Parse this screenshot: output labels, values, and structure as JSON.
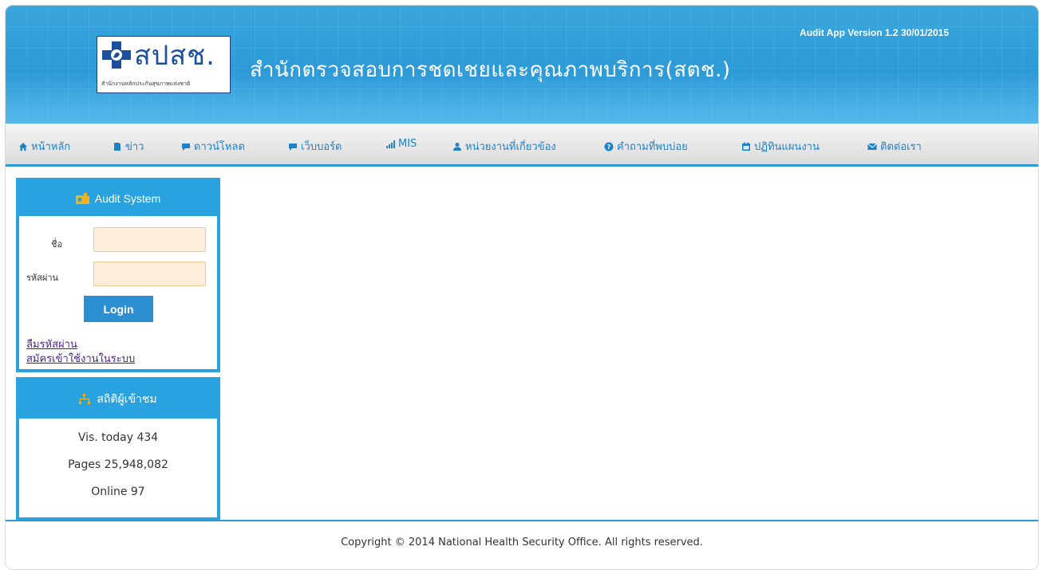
{
  "header": {
    "logo_text": "สปสช.",
    "logo_subtitle": "สำนักงานหลักประกันสุขภาพแห่งชาติ",
    "site_title": "สำนักตรวจสอบการชดเชยและคุณภาพบริการ(สตช.)",
    "app_version": "Audit App Version 1.2 30/01/2015"
  },
  "nav": {
    "items": [
      {
        "label": "หน้าหลัก",
        "icon": "home-icon"
      },
      {
        "label": "ข่าว",
        "icon": "document-icon"
      },
      {
        "label": "ดาวน์โหลด",
        "icon": "comment-icon"
      },
      {
        "label": "เว็บบอร์ด",
        "icon": "comment-icon"
      },
      {
        "label": "MIS",
        "icon": "signal-icon"
      },
      {
        "label": "หน่วยงานที่เกี่ยวข้อง",
        "icon": "user-icon"
      },
      {
        "label": "คำถามที่พบบ่อย",
        "icon": "question-icon"
      },
      {
        "label": "ปฏิทินแผนงาน",
        "icon": "calendar-icon"
      },
      {
        "label": "ติดต่อเรา",
        "icon": "envelope-icon"
      }
    ]
  },
  "audit_panel": {
    "title": "Audit System",
    "name_label": "ชื่อ",
    "name_value": "",
    "password_label": "รหัสผ่าน",
    "password_value": "",
    "login_label": "Login",
    "forgot_password": "ลืมรหัสผ่าน",
    "register": "สมัครเข้าใช้งานในระบบ"
  },
  "stats_panel": {
    "title": "สถิติผู้เข้าชม",
    "visits_today": "Vis. today 434",
    "pages": "Pages 25,948,082",
    "online": "Online 97"
  },
  "footer": {
    "copyright": "Copyright © 2014 National Health Security Office. All rights reserved."
  },
  "colors": {
    "header_blue": "#2d9ad6",
    "panel_blue": "#29a3df",
    "nav_text": "#1e82c8",
    "input_bg": "#fdeedb",
    "link_purple": "#4a1d8f"
  }
}
